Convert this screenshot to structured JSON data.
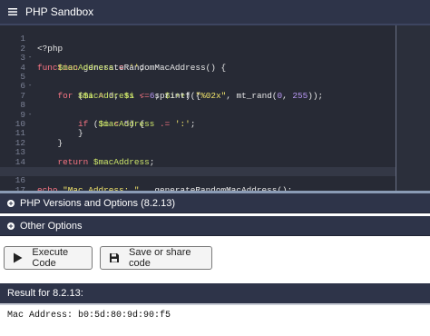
{
  "header": {
    "title": "PHP Sandbox",
    "icon": "hamburger-icon"
  },
  "editor": {
    "lines": [
      {
        "n": "1",
        "fold": ""
      },
      {
        "n": "2",
        "fold": "-"
      },
      {
        "n": "3",
        "fold": ""
      },
      {
        "n": "4",
        "fold": ""
      },
      {
        "n": "5",
        "fold": "-"
      },
      {
        "n": "6",
        "fold": ""
      },
      {
        "n": "7",
        "fold": ""
      },
      {
        "n": "8",
        "fold": "-"
      },
      {
        "n": "9",
        "fold": ""
      },
      {
        "n": "10",
        "fold": ""
      },
      {
        "n": "11",
        "fold": ""
      },
      {
        "n": "12",
        "fold": ""
      },
      {
        "n": "13",
        "fold": ""
      },
      {
        "n": "14",
        "fold": ""
      },
      {
        "n": "15",
        "fold": ""
      },
      {
        "n": "16",
        "fold": ""
      },
      {
        "n": "17",
        "fold": ""
      },
      {
        "n": "18",
        "fold": ""
      }
    ],
    "code": {
      "l1": "<?php",
      "l2_kw": "function",
      "l2_rest": " generateRandomMacAddress() {",
      "l3_var": "$macAddress",
      "l3_op": " = ",
      "l3_str": "''",
      "l3_end": ";",
      "l5_kw": "for",
      "l5_a": " (",
      "l5_v1": "$i",
      "l5_b": " = ",
      "l5_n0": "0",
      "l5_c": "; ",
      "l5_v2": "$i",
      "l5_d": " < ",
      "l5_n6": "6",
      "l5_e": "; ",
      "l5_v3": "$i++",
      "l5_f": ") {",
      "l6_var": "$macAddress",
      "l6_op": " .= ",
      "l6_fn": "sprintf(",
      "l6_str": "\"%02x\"",
      "l6_mid": ", mt_rand(",
      "l6_n0": "0",
      "l6_sep": ", ",
      "l6_n255": "255",
      "l6_end": "));",
      "l8_kw": "if",
      "l8_a": " (",
      "l8_var": "$i",
      "l8_op": " < ",
      "l8_n5": "5",
      "l8_end": ") {",
      "l9_var": "$macAddress",
      "l9_op": " .= ",
      "l9_str": "':'",
      "l9_end": ";",
      "l10": "}",
      "l11": "}",
      "l13_kw": "return",
      "l13_var": " $macAddress",
      "l13_end": ";",
      "l14": "}",
      "l16_kw": "echo",
      "l16_str": " \"Mac Address: \"",
      "l16_rest": " . generateRandomMacAddress();",
      "l18": "?>"
    }
  },
  "sections": {
    "versions_label": "PHP Versions and Options (8.2.13)",
    "other_label": "Other Options"
  },
  "buttons": {
    "execute_label": "Execute Code",
    "save_label": "Save or share code"
  },
  "result": {
    "header": "Result for 8.2.13:",
    "output": "Mac Address: b0:5d:80:9d:90:f5"
  }
}
